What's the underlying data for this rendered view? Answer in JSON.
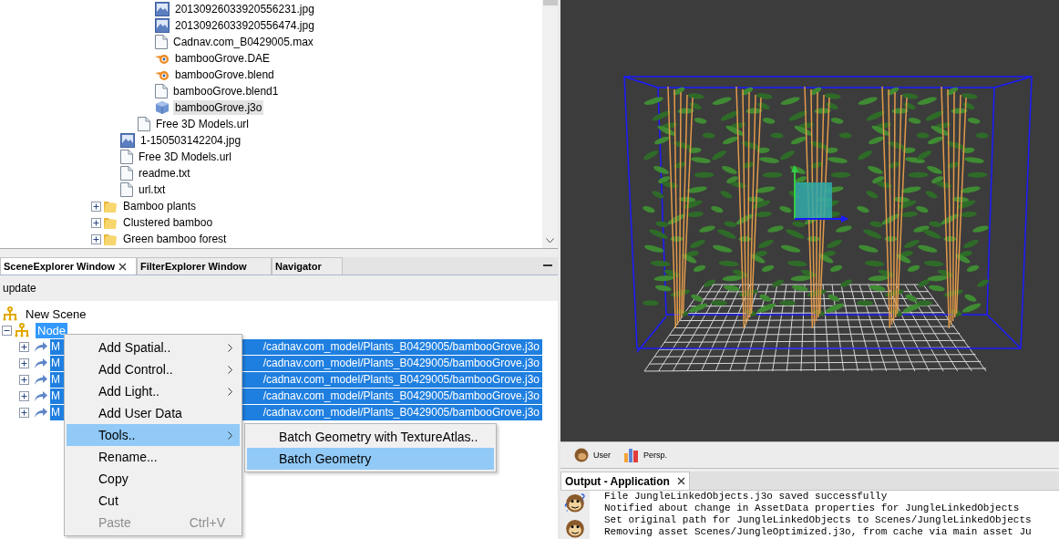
{
  "file_tree": {
    "items": [
      {
        "children": [
          {
            "children": [
              {
                "children": [
                  {
                    "label": "20130926033920556231.jpg",
                    "kind": "image",
                    "selected": false
                  },
                  {
                    "label": "20130926033920556474.jpg",
                    "kind": "image",
                    "selected": false
                  },
                  {
                    "label": "Cadnav.com_B0429005.max",
                    "kind": "file",
                    "selected": false
                  },
                  {
                    "label": "bambooGrove.DAE",
                    "kind": "blender",
                    "selected": false
                  },
                  {
                    "label": "bambooGrove.blend",
                    "kind": "blender",
                    "selected": false
                  },
                  {
                    "label": "bambooGrove.blend1",
                    "kind": "file",
                    "selected": false
                  },
                  {
                    "label": "bambooGrove.j3o",
                    "kind": "model",
                    "selected": true
                  }
                ]
              },
              {
                "label": "Free 3D Models.url",
                "kind": "file",
                "selected": false
              }
            ]
          },
          {
            "label": "1-150503142204.jpg",
            "kind": "image",
            "selected": false
          },
          {
            "label": "Free 3D Models.url",
            "kind": "file",
            "selected": false
          },
          {
            "label": "readme.txt",
            "kind": "file",
            "selected": false
          },
          {
            "label": "url.txt",
            "kind": "file",
            "selected": false
          }
        ]
      },
      {
        "label": "Bamboo plants",
        "kind": "folder",
        "expanded": false,
        "selected": false
      },
      {
        "label": "Clustered bamboo",
        "kind": "folder",
        "expanded": false,
        "selected": false
      },
      {
        "label": "Green bamboo forest",
        "kind": "folder",
        "expanded": false,
        "selected": false
      }
    ]
  },
  "scene_panel": {
    "tabs": [
      {
        "label": "SceneExplorer Window",
        "selected": true,
        "closable": true
      },
      {
        "label": "FilterExplorer Window",
        "selected": false,
        "closable": false
      },
      {
        "label": "Navigator",
        "selected": false,
        "closable": false
      }
    ],
    "toolbar_button": "update",
    "tree": [
      {
        "label": "New Scene",
        "kind": "node",
        "selected": false
      },
      {
        "label": "Node",
        "kind": "node",
        "expanded": true,
        "selected": true,
        "children": [
          {
            "label_start": "M",
            "label_end": "/cadnav.com_model/Plants_B0429005/bambooGrove.j3o",
            "kind": "link",
            "expanded": false,
            "selected": true
          },
          {
            "label_start": "M",
            "label_end": "/cadnav.com_model/Plants_B0429005/bambooGrove.j3o",
            "kind": "link",
            "expanded": false,
            "selected": true
          },
          {
            "label_start": "M",
            "label_end": "/cadnav.com_model/Plants_B0429005/bambooGrove.j3o",
            "kind": "link",
            "expanded": false,
            "selected": true
          },
          {
            "label_start": "M",
            "label_end": "/cadnav.com_model/Plants_B0429005/bambooGrove.j3o",
            "kind": "link",
            "expanded": false,
            "selected": true
          },
          {
            "label_start": "M",
            "label_end": "/cadnav.com_model/Plants_B0429005/bambooGrove.j3o",
            "kind": "link",
            "expanded": false,
            "selected": true
          }
        ]
      }
    ]
  },
  "context_menu": {
    "items": [
      {
        "label": "Add Spatial..",
        "submenu": true,
        "selected": false,
        "disabled": false
      },
      {
        "label": "Add Control..",
        "submenu": true,
        "selected": false,
        "disabled": false
      },
      {
        "label": "Add Light..",
        "submenu": true,
        "selected": false,
        "disabled": false
      },
      {
        "label": "Add User Data",
        "submenu": false,
        "selected": false,
        "disabled": false
      },
      {
        "label": "Tools..",
        "submenu": true,
        "selected": true,
        "disabled": false
      },
      {
        "label": "Rename...",
        "submenu": false,
        "selected": false,
        "disabled": false
      },
      {
        "label": "Copy",
        "submenu": false,
        "selected": false,
        "disabled": false
      },
      {
        "label": "Cut",
        "submenu": false,
        "selected": false,
        "disabled": false
      },
      {
        "label": "Paste",
        "submenu": false,
        "selected": false,
        "disabled": true,
        "shortcut": "Ctrl+V"
      }
    ]
  },
  "submenu": {
    "items": [
      {
        "label": "Batch Geometry with TextureAtlas..",
        "selected": false
      },
      {
        "label": "Batch Geometry",
        "selected": true
      }
    ]
  },
  "viewport_toolbar": [
    {
      "label": "User",
      "kind": "monkey"
    },
    {
      "label": "Persp.",
      "kind": "bars"
    }
  ],
  "output": {
    "tab": {
      "label": "Output - Application",
      "selected": true,
      "closable": true
    },
    "gutter_icons": [
      {
        "kind": "question"
      },
      {
        "kind": "plain"
      }
    ],
    "lines": [
      "File JungleLinkedObjects.j3o saved successfully",
      "Notified about change in AssetData properties for JungleLinkedObjects",
      "Set original path for JungleLinkedObjects to Scenes/JungleLinkedObjects",
      "Removing asset Scenes/JungleOptimized.j3o, from cache via main asset Ju"
    ]
  }
}
